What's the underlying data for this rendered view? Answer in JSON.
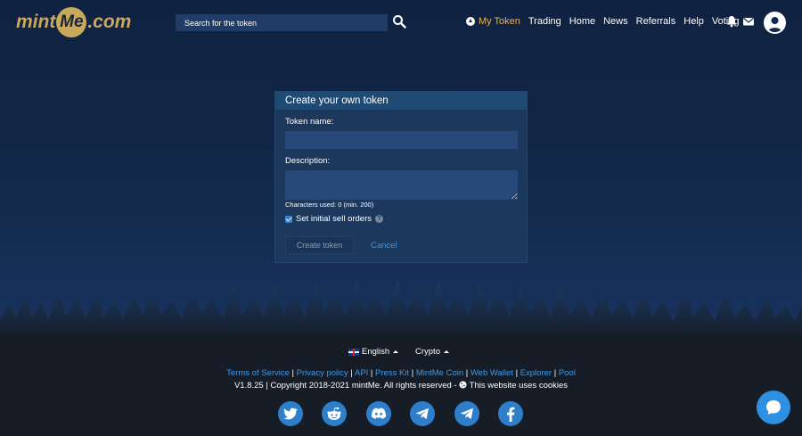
{
  "logo": {
    "part1": "mint",
    "part2": "Me",
    "part3": ".com"
  },
  "search": {
    "placeholder": "Search for the token"
  },
  "nav": {
    "my_token": "My Token",
    "items": [
      "Trading",
      "Home",
      "News",
      "Referrals",
      "Help",
      "Voting"
    ]
  },
  "card": {
    "title": "Create your own token",
    "token_name_label": "Token name:",
    "token_name_value": "",
    "description_label": "Description:",
    "description_value": "",
    "chars_used": "Characters used: 0 (min. 200)",
    "initial_sell_orders_label": "Set initial sell orders",
    "initial_sell_orders_checked": true,
    "help_icon_text": "?",
    "create_label": "Create token",
    "cancel_label": "Cancel"
  },
  "footer": {
    "language": "English",
    "crypto": "Crypto",
    "links": [
      "Terms of Service",
      "Privacy policy",
      "API",
      "Press Kit",
      "MintMe Coin",
      "Web Wallet",
      "Explorer",
      "Pool"
    ],
    "version_copyright": "V1.8.25 | Copyright 2018-2021 mintMe. All rights reserved - ",
    "cookies": "This website uses cookies",
    "socials": [
      "twitter-icon",
      "reddit-icon",
      "discord-icon",
      "telegram-icon",
      "telegram-icon",
      "facebook-icon"
    ]
  },
  "colors": {
    "accent": "#3f97e8",
    "gold": "#c9a95a",
    "active_nav": "#f0b04a",
    "footer_bg": "#161d27"
  }
}
